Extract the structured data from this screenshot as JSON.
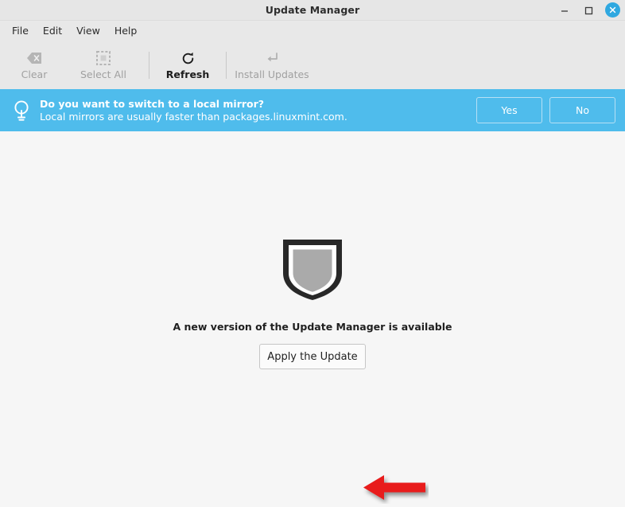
{
  "window": {
    "title": "Update Manager",
    "controls": {
      "minimize": "minimize",
      "maximize": "maximize",
      "close": "close"
    }
  },
  "menubar": {
    "items": [
      {
        "label": "File"
      },
      {
        "label": "Edit"
      },
      {
        "label": "View"
      },
      {
        "label": "Help"
      }
    ]
  },
  "toolbar": {
    "buttons": [
      {
        "label": "Clear",
        "icon": "clear-icon",
        "enabled": false
      },
      {
        "label": "Select All",
        "icon": "select-all-icon",
        "enabled": false
      },
      {
        "label": "Refresh",
        "icon": "refresh-icon",
        "enabled": true
      },
      {
        "label": "Install Updates",
        "icon": "install-updates-icon",
        "enabled": false
      }
    ]
  },
  "infobar": {
    "icon": "lightbulb-icon",
    "title": "Do you want to switch to a local mirror?",
    "subtitle": "Local mirrors are usually faster than packages.linuxmint.com.",
    "yes_label": "Yes",
    "no_label": "No",
    "background_color": "#4fbcec"
  },
  "main": {
    "icon": "shield-icon",
    "status_text": "A new version of the Update Manager is available",
    "apply_label": "Apply the Update"
  },
  "annotation": {
    "arrow": "left-pointing-arrow",
    "color": "#e81b1b"
  }
}
